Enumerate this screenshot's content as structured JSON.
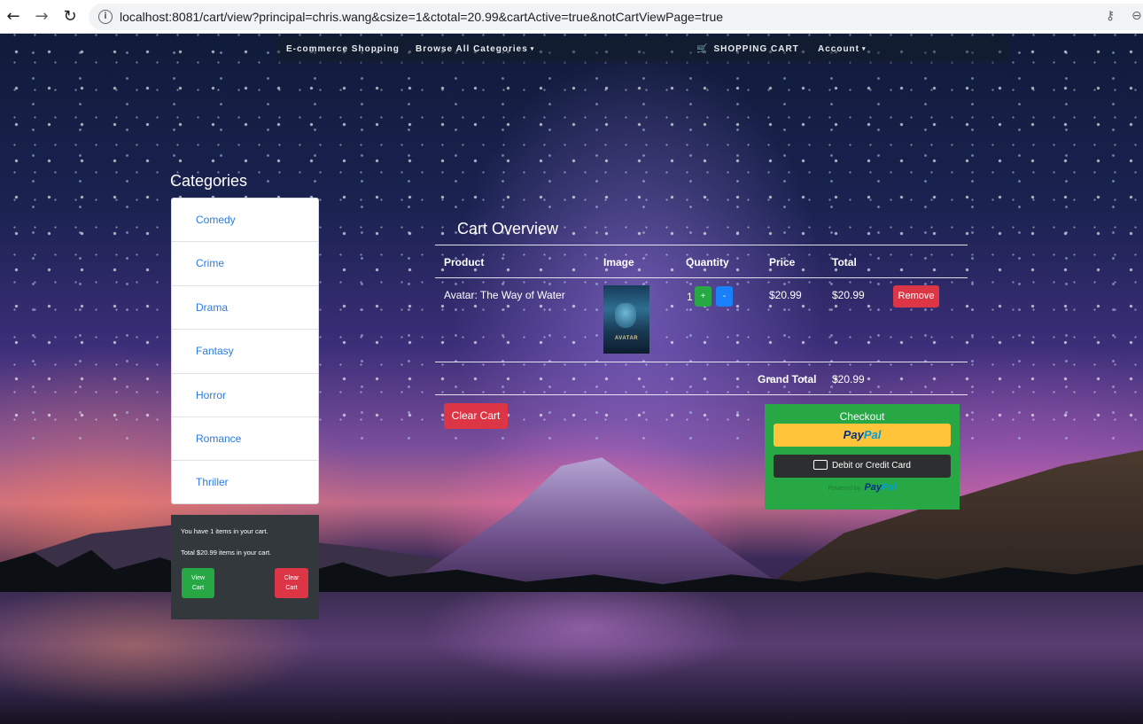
{
  "browser": {
    "url": "localhost:8081/cart/view?principal=chris.wang&csize=1&ctotal=20.99&cartActive=true&notCartViewPage=true",
    "back_icon": "←",
    "forward_icon": "→",
    "reload_icon": "↻",
    "info_icon": "i",
    "key_icon": "⚷",
    "zoom_icon": "⊖"
  },
  "navbar": {
    "brand": "E-commerce Shopping",
    "browse": "Browse All Categories",
    "cart": "SHOPPING CART",
    "account": "Account",
    "caret": "▾",
    "cart_icon": "🛒"
  },
  "sidebar": {
    "title": "Categories",
    "items": [
      "Comedy",
      "Crime",
      "Drama",
      "Fantasy",
      "Horror",
      "Romance",
      "Thriller"
    ]
  },
  "mini_cart": {
    "line1": "You have 1 items in your cart.",
    "line2": "Total $20.99 items in your cart.",
    "view_l1": "View",
    "view_l2": "Cart",
    "clear_l1": "Clear",
    "clear_l2": "Cart"
  },
  "cart": {
    "title": "Cart Overview",
    "headers": {
      "product": "Product",
      "image": "Image",
      "quantity": "Quantity",
      "price": "Price",
      "total": "Total"
    },
    "rows": [
      {
        "product": "Avatar: The Way of Water",
        "poster_text": "AVATAR",
        "quantity": "1",
        "plus": "+",
        "minus": "-",
        "price": "$20.99",
        "total": "$20.99",
        "remove": "Remove"
      }
    ],
    "grand_total_label": "Grand Total",
    "grand_total": "$20.99",
    "clear_cart": "Clear Cart"
  },
  "checkout": {
    "title": "Checkout",
    "paypal_a": "Pay",
    "paypal_b": "Pal",
    "card_button": "Debit or Credit Card",
    "powered_by": "Powered by"
  },
  "colors": {
    "success": "#28a745",
    "danger": "#dc3545",
    "primary": "#1a7ffb",
    "paypal_yellow": "#ffc439",
    "link": "#2a7be0"
  }
}
